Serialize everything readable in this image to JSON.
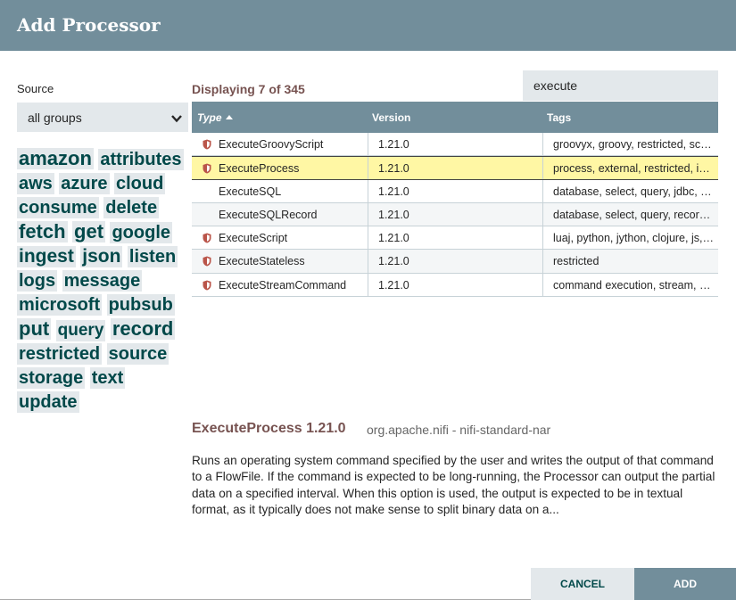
{
  "dialog": {
    "title": "Add Processor"
  },
  "source": {
    "label": "Source",
    "selected": "all groups"
  },
  "tags": [
    {
      "label": "amazon",
      "size": 22
    },
    {
      "label": "attributes",
      "size": 20
    },
    {
      "label": "aws",
      "size": 20
    },
    {
      "label": "azure",
      "size": 20
    },
    {
      "label": "cloud",
      "size": 20
    },
    {
      "label": "consume",
      "size": 20
    },
    {
      "label": "delete",
      "size": 20
    },
    {
      "label": "fetch",
      "size": 22
    },
    {
      "label": "get",
      "size": 22
    },
    {
      "label": "google",
      "size": 20
    },
    {
      "label": "ingest",
      "size": 21
    },
    {
      "label": "json",
      "size": 21
    },
    {
      "label": "listen",
      "size": 20
    },
    {
      "label": "logs",
      "size": 20
    },
    {
      "label": "message",
      "size": 20
    },
    {
      "label": "microsoft",
      "size": 20
    },
    {
      "label": "pubsub",
      "size": 20
    },
    {
      "label": "put",
      "size": 22
    },
    {
      "label": "query",
      "size": 19
    },
    {
      "label": "record",
      "size": 22
    },
    {
      "label": "restricted",
      "size": 20
    },
    {
      "label": "source",
      "size": 20
    },
    {
      "label": "storage",
      "size": 20
    },
    {
      "label": "text",
      "size": 20
    },
    {
      "label": "update",
      "size": 20
    }
  ],
  "results": {
    "displaying": "Displaying 7 of 345",
    "filter_value": "execute"
  },
  "table": {
    "headers": {
      "type": "Type",
      "version": "Version",
      "tags": "Tags"
    },
    "rows": [
      {
        "type": "ExecuteGroovyScript",
        "version": "1.21.0",
        "tags": "groovyx, groovy, restricted, script, ...",
        "restricted": true,
        "selected": false
      },
      {
        "type": "ExecuteProcess",
        "version": "1.21.0",
        "tags": "process, external, restricted, invoke, ...",
        "restricted": true,
        "selected": true
      },
      {
        "type": "ExecuteSQL",
        "version": "1.21.0",
        "tags": "database, select, query, jdbc, sql, ...",
        "restricted": false,
        "selected": false
      },
      {
        "type": "ExecuteSQLRecord",
        "version": "1.21.0",
        "tags": "database, select, query, record, sql, ...",
        "restricted": false,
        "selected": false
      },
      {
        "type": "ExecuteScript",
        "version": "1.21.0",
        "tags": "luaj, python, jython, clojure, js, ...",
        "restricted": true,
        "selected": false
      },
      {
        "type": "ExecuteStateless",
        "version": "1.21.0",
        "tags": "restricted",
        "restricted": true,
        "selected": false
      },
      {
        "type": "ExecuteStreamCommand",
        "version": "1.21.0",
        "tags": "command execution, stream, command, ...",
        "restricted": true,
        "selected": false
      }
    ]
  },
  "detail": {
    "title": "ExecuteProcess 1.21.0",
    "bundle": "org.apache.nifi - nifi-standard-nar",
    "description": "Runs an operating system command specified by the user and writes the output of that command to a FlowFile. If the command is expected to be long-running, the Processor can output the partial data on a specified interval. When this option is used, the output is expected to be in textual format, as it typically does not make sense to split binary data on a..."
  },
  "buttons": {
    "cancel": "CANCEL",
    "add": "ADD"
  },
  "colors": {
    "header": "#728e9b",
    "accent_text": "#775351",
    "tag_text": "#004849",
    "selected_row": "#fff7a4",
    "restricted_icon": "#ba554a"
  }
}
